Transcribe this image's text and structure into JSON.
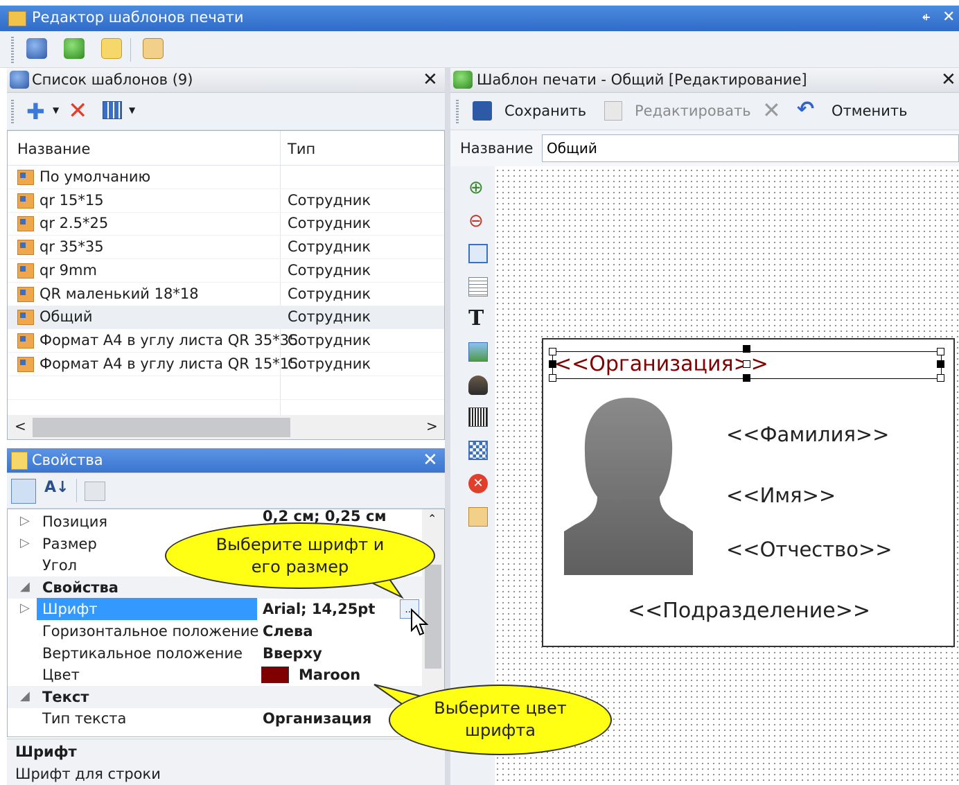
{
  "window": {
    "title": "Редактор шаблонов печати",
    "pin_glyph": "⍅",
    "close_glyph": "✕"
  },
  "main_toolbar": {
    "icons": [
      "database-icon",
      "green-gem-icon",
      "edit-pad-icon",
      "export-icon"
    ]
  },
  "templates_panel": {
    "title": "Список шаблонов (9)",
    "columns": [
      "Название",
      "Тип"
    ],
    "rows": [
      {
        "name": "По умолчанию",
        "type": ""
      },
      {
        "name": "qr 15*15",
        "type": "Сотрудник"
      },
      {
        "name": "qr 2.5*25",
        "type": "Сотрудник"
      },
      {
        "name": "qr 35*35",
        "type": "Сотрудник"
      },
      {
        "name": "qr 9mm",
        "type": "Сотрудник"
      },
      {
        "name": "QR маленький 18*18",
        "type": "Сотрудник"
      },
      {
        "name": "Общий",
        "type": "Сотрудник"
      },
      {
        "name": "Формат А4 в углу листа QR 35*35",
        "type": "Сотрудник"
      },
      {
        "name": "Формат А4 в углу листа QR 15*15",
        "type": "Сотрудник"
      }
    ],
    "selected_row": "Общий"
  },
  "properties_panel": {
    "title": "Свойства",
    "rows": [
      {
        "name": "Позиция",
        "value": "0,2 см; 0,25 см",
        "kind": "expand"
      },
      {
        "name": "Размер",
        "value": "",
        "kind": "expand"
      },
      {
        "name": "Угол",
        "value": "",
        "kind": "plain"
      },
      {
        "name": "Свойства",
        "value": "",
        "kind": "category"
      },
      {
        "name": "Шрифт",
        "value": "Arial; 14,25pt",
        "kind": "selected"
      },
      {
        "name": "Горизонтальное положение",
        "value": "Слева",
        "kind": "plain"
      },
      {
        "name": "Вертикальное положение",
        "value": "Вверху",
        "kind": "plain"
      },
      {
        "name": "Цвет",
        "value": "Maroon",
        "kind": "color"
      },
      {
        "name": "Текст",
        "value": "",
        "kind": "category"
      },
      {
        "name": "Тип текста",
        "value": "Организация",
        "kind": "plain"
      }
    ],
    "ellipsis": "...",
    "color_swatch": "#800000",
    "description_title": "Шрифт",
    "description_text": "Шрифт для строки"
  },
  "editor_panel": {
    "title": "Шаблон печати - Общий [Редактирование]",
    "save": "Сохранить",
    "edit": "Редактировать",
    "cancel": "Отменить",
    "name_label": "Название",
    "name_value": "Общий",
    "text_tool": "T"
  },
  "card": {
    "org": "<<Организация>>",
    "surname": "<<Фамилия>>",
    "name": "<<Имя>>",
    "patronymic": "<<Отчество>>",
    "department": "<<Подразделение>>",
    "org_color": "#800000"
  },
  "callouts": {
    "font": "Выберите шрифт и его размер",
    "color": "Выберите цвет шрифта"
  }
}
